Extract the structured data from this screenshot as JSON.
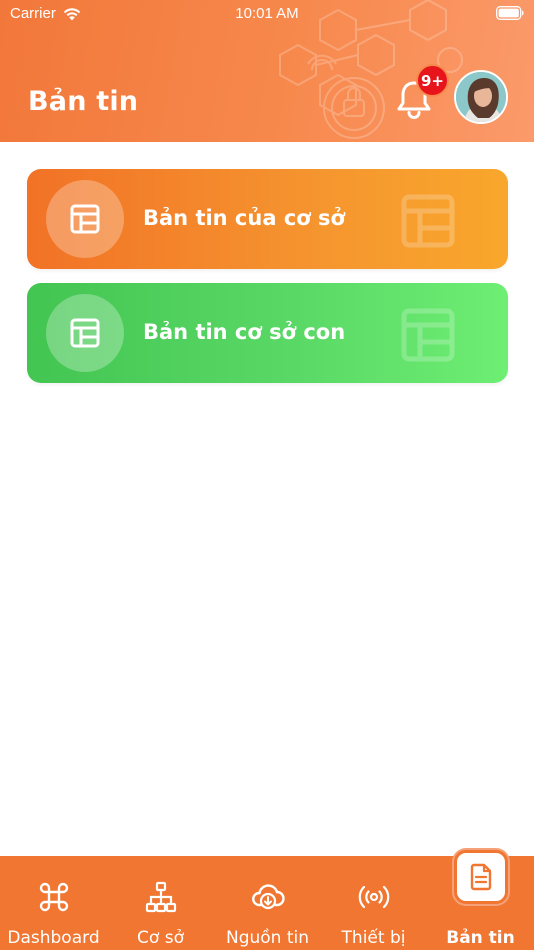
{
  "status_bar": {
    "carrier": "Carrier",
    "time": "10:01 AM"
  },
  "header": {
    "title": "Bản tin",
    "notification_badge": "9+"
  },
  "cards": [
    {
      "label": "Bản tin của cơ sở",
      "icon": "newspaper-icon",
      "color": "#f58c2c"
    },
    {
      "label": "Bản tin cơ sở con",
      "icon": "newspaper-icon",
      "color": "#55d362"
    }
  ],
  "tabs": [
    {
      "label": "Dashboard",
      "icon": "command-icon"
    },
    {
      "label": "Cơ sở",
      "icon": "hierarchy-icon"
    },
    {
      "label": "Nguồn tin",
      "icon": "cloud-download-icon"
    },
    {
      "label": "Thiết bị",
      "icon": "broadcast-icon"
    },
    {
      "label": "Bản tin",
      "icon": "document-icon",
      "active": true
    }
  ],
  "colors": {
    "accent": "#f07631",
    "header_gradient_end": "#fb9a6b",
    "badge": "#e8141b"
  }
}
